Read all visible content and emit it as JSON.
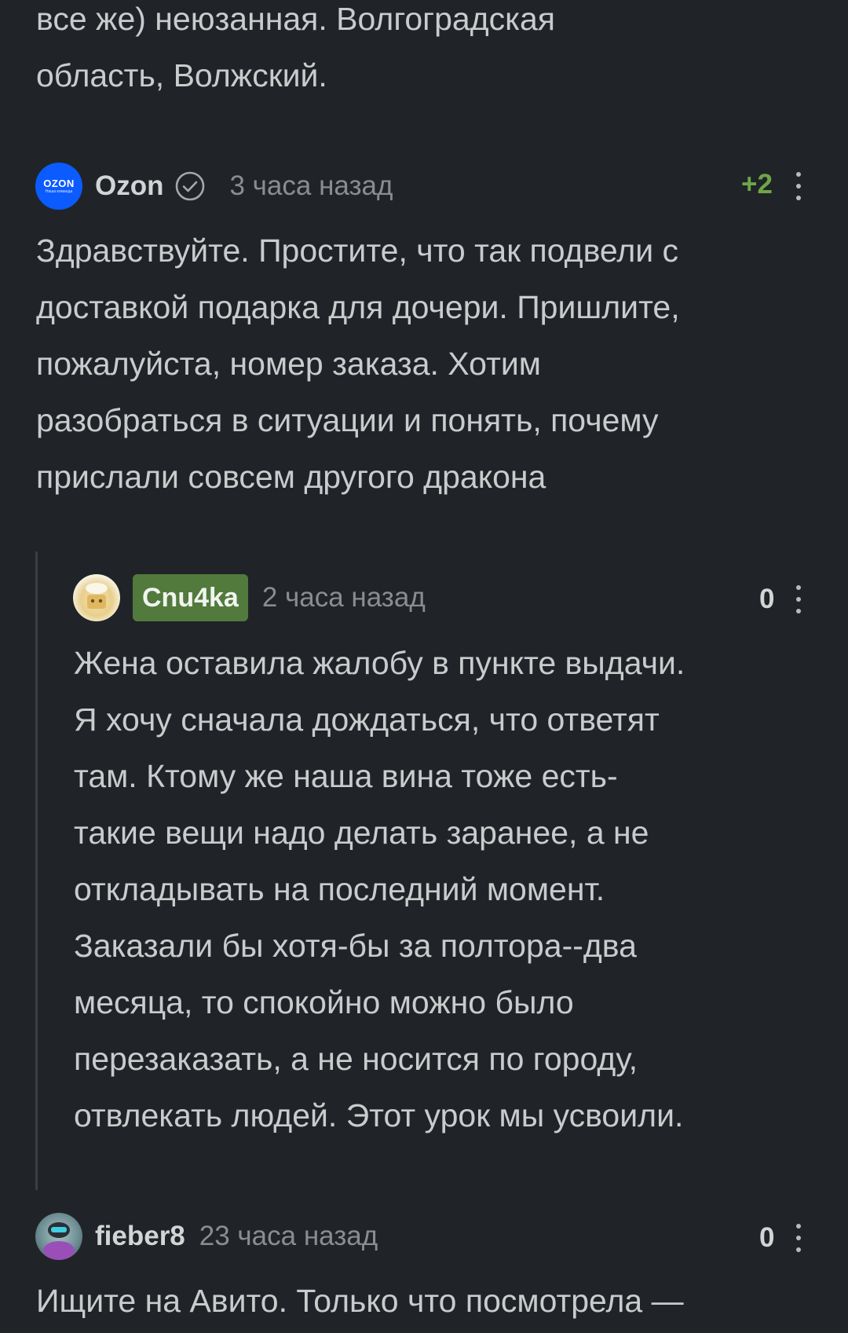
{
  "top_comment": {
    "lines": [
      "все же) неюзанная. Волгоградская",
      "область, Волжский."
    ]
  },
  "comment_ozon": {
    "avatar_text": "OZON",
    "avatar_subtext": "Наша команда",
    "author": "Ozon",
    "time": "3 часа назад",
    "rating": "+2",
    "lines": [
      "Здравствуйте. Простите, что так подвели с",
      "доставкой подарка для дочери. Пришлите,",
      "пожалуйста, номер заказа. Хотим",
      "разобраться в ситуации и понять, почему",
      "прислали совсем другого дракона"
    ]
  },
  "comment_reply": {
    "author": "Cnu4ka",
    "time": "2 часа назад",
    "rating": "0",
    "lines": [
      "Жена оставила жалобу в пункте выдачи.",
      "Я хочу сначала дождаться, что ответят",
      "там. Ктому же наша вина тоже есть-",
      "такие вещи надо делать заранее, а не",
      "откладывать на последний момент.",
      "Заказали бы хотя-бы за полтора--два",
      "месяца, то спокойно можно было",
      "перезаказать, а не носится по городу,",
      "отвлекать людей. Этот урок мы усвоили."
    ]
  },
  "comment_fieber": {
    "author": "fieber8",
    "time": "23 часа назад",
    "rating": "0",
    "lines": [
      "Ищите на Авито. Только что посмотрела —"
    ]
  },
  "colors": {
    "background": "#202428",
    "positive_rating": "#6ea646",
    "author_badge": "#527a3d",
    "ozon_blue": "#0b5bff",
    "thread_line": "#3b3f43"
  },
  "icons": {
    "verified": "check-circle-icon",
    "more": "kebab-menu-icon"
  }
}
